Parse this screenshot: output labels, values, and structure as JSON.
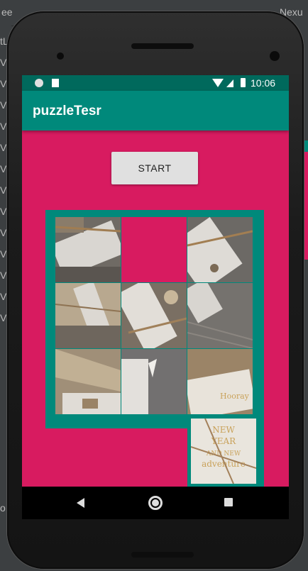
{
  "ide": {
    "top_left_text": "ee",
    "top_right_text": "Nexu",
    "left_items": [
      "tLa",
      "Vi",
      "Vi",
      "Vi",
      "Vi",
      "Vi",
      "Vi",
      "Vi",
      "Vi",
      "Vi",
      "Vi",
      "Vi",
      "Vi",
      "Vi"
    ],
    "bottom_left_text": "o"
  },
  "statusbar": {
    "time": "10:06",
    "icons": [
      "notification-circle-icon",
      "sd-card-icon",
      "wifi-icon",
      "signal-icon",
      "battery-icon"
    ]
  },
  "app": {
    "title": "puzzleTesr",
    "start_label": "START"
  },
  "puzzle": {
    "grid": 3,
    "empty_cell": [
      0,
      1
    ],
    "tiles": [
      "tile-1",
      "empty",
      "tile-3",
      "tile-4",
      "tile-5",
      "tile-6",
      "tile-7",
      "tile-8",
      "tile-9",
      "tile-10"
    ]
  },
  "navbar": {
    "icons": [
      "back-icon",
      "home-icon",
      "recents-icon"
    ]
  },
  "colors": {
    "background": "#d81b60",
    "appbar": "#00897b",
    "statusbar": "#00695c",
    "board_frame": "#00897b",
    "button": "#e0e0e0"
  }
}
